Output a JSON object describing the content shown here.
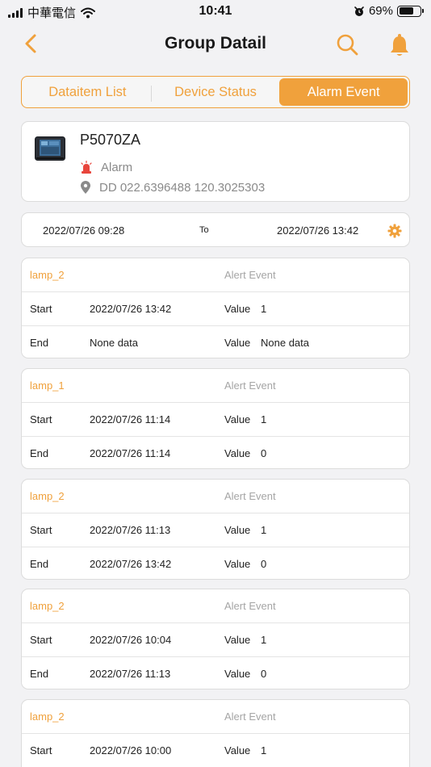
{
  "status_bar": {
    "carrier": "中華電信",
    "time": "10:41",
    "battery_percent": "69%",
    "battery_level": 0.69,
    "icons": [
      "signal-icon",
      "wifi-icon",
      "alarm-clock-icon",
      "battery-icon"
    ]
  },
  "nav": {
    "title": "Group Datail",
    "icons": [
      "back-chevron-icon",
      "search-icon",
      "bell-icon"
    ]
  },
  "tabs": [
    {
      "label": "Dataitem List",
      "active": false
    },
    {
      "label": "Device Status",
      "active": false
    },
    {
      "label": "Alarm Event",
      "active": true
    }
  ],
  "device": {
    "name": "P5070ZA",
    "status": "Alarm",
    "location": "DD 022.6396488 120.3025303"
  },
  "range": {
    "start": "2022/07/26 09:28",
    "to": "To",
    "end": "2022/07/26 13:42"
  },
  "labels": {
    "start": "Start",
    "end": "End",
    "value": "Value"
  },
  "events": [
    {
      "name": "lamp_2",
      "type": "Alert Event",
      "start": "2022/07/26 13:42",
      "start_value": "1",
      "end": "None data",
      "end_value": "None data"
    },
    {
      "name": "lamp_1",
      "type": "Alert Event",
      "start": "2022/07/26 11:14",
      "start_value": "1",
      "end": "2022/07/26 11:14",
      "end_value": "0"
    },
    {
      "name": "lamp_2",
      "type": "Alert Event",
      "start": "2022/07/26 11:13",
      "start_value": "1",
      "end": "2022/07/26 13:42",
      "end_value": "0"
    },
    {
      "name": "lamp_2",
      "type": "Alert Event",
      "start": "2022/07/26 10:04",
      "start_value": "1",
      "end": "2022/07/26 11:13",
      "end_value": "0"
    },
    {
      "name": "lamp_2",
      "type": "Alert Event",
      "start": "2022/07/26 10:00",
      "start_value": "1"
    }
  ],
  "colors": {
    "accent": "#f0a13c",
    "background": "#f2f2f4",
    "alarm_icon": "#e8453c"
  }
}
